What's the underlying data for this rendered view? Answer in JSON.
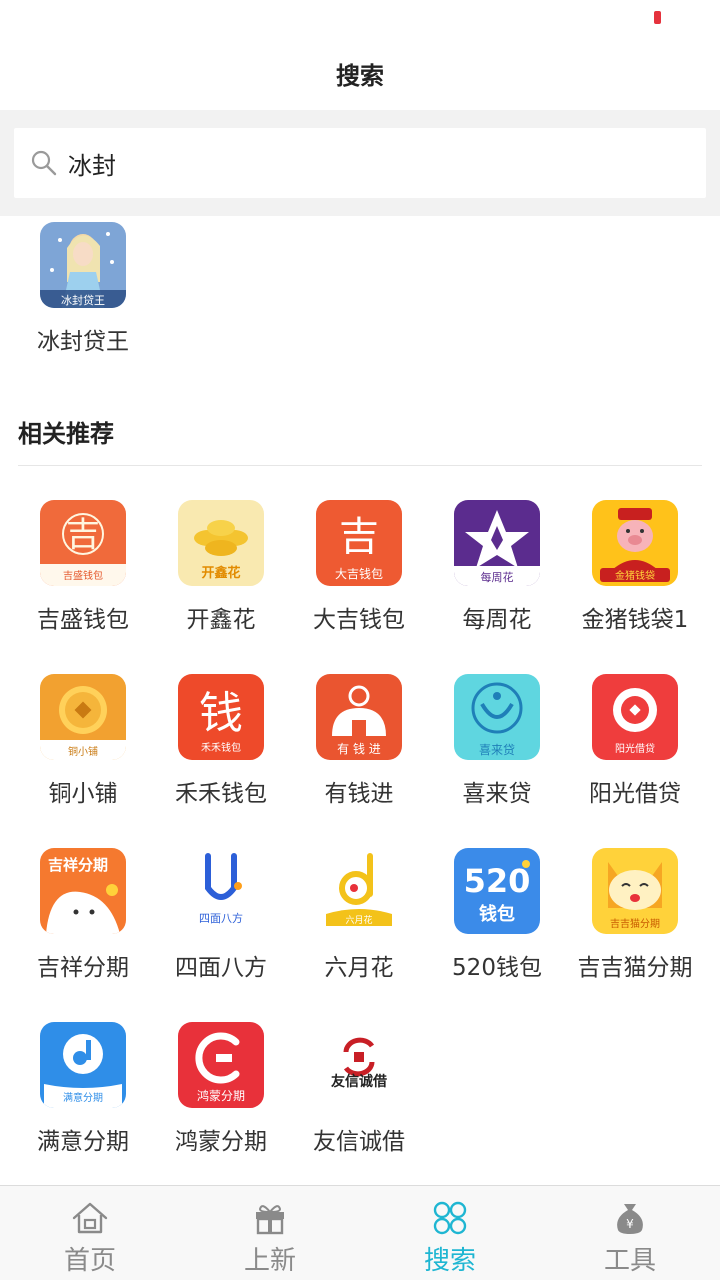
{
  "header": {
    "title": "搜索"
  },
  "search": {
    "value": "冰封",
    "placeholder": ""
  },
  "result": {
    "name": "冰封贷王",
    "icon_caption": "冰封贷王"
  },
  "recommend": {
    "title": "相关推荐",
    "apps": [
      {
        "name": "吉盛钱包",
        "icon_caption": "吉盛钱包",
        "color": "#f06a3b"
      },
      {
        "name": "开鑫花",
        "icon_caption": "开鑫花",
        "color": "#f9e7a8"
      },
      {
        "name": "大吉钱包",
        "icon_caption": "大吉钱包",
        "color": "#ee5a32"
      },
      {
        "name": "每周花",
        "icon_caption": "每周花",
        "color": "#5b2c8e"
      },
      {
        "name": "金猪钱袋1",
        "icon_caption": "金猪钱袋",
        "color": "#ffc21a"
      },
      {
        "name": "铜小铺",
        "icon_caption": "铜小铺",
        "color": "#f2a130"
      },
      {
        "name": "禾禾钱包",
        "icon_caption": "禾禾钱包",
        "color": "#ee4a2a"
      },
      {
        "name": "有钱进",
        "icon_caption": "有 钱 进",
        "color": "#ea5530"
      },
      {
        "name": "喜来贷",
        "icon_caption": "喜来贷",
        "color": "#5fd6e0"
      },
      {
        "name": "阳光借贷",
        "icon_caption": "阳光借贷",
        "color": "#ef3d3d"
      },
      {
        "name": "吉祥分期",
        "icon_caption": "吉祥分期",
        "color": "#f5792f"
      },
      {
        "name": "四面八方",
        "icon_caption": "四面八方",
        "color": "#ffffff"
      },
      {
        "name": "六月花",
        "icon_caption": "六月花",
        "color": "#ffffff"
      },
      {
        "name": "520钱包",
        "icon_caption": "520钱包",
        "color": "#3b8be9"
      },
      {
        "name": "吉吉猫分期",
        "icon_caption": "吉吉猫分期",
        "color": "#ffd23a"
      },
      {
        "name": "满意分期",
        "icon_caption": "满意分期",
        "color": "#2f8ee8"
      },
      {
        "name": "鸿蒙分期",
        "icon_caption": "鸿蒙分期",
        "color": "#e8313a"
      },
      {
        "name": "友信诚借",
        "icon_caption": "友信诚借",
        "color": "#ffffff"
      }
    ]
  },
  "tabbar": {
    "items": [
      {
        "label": "首页",
        "icon": "home-icon"
      },
      {
        "label": "上新",
        "icon": "gift-icon"
      },
      {
        "label": "搜索",
        "icon": "clover-icon",
        "active": true
      },
      {
        "label": "工具",
        "icon": "money-bag-icon"
      }
    ]
  }
}
